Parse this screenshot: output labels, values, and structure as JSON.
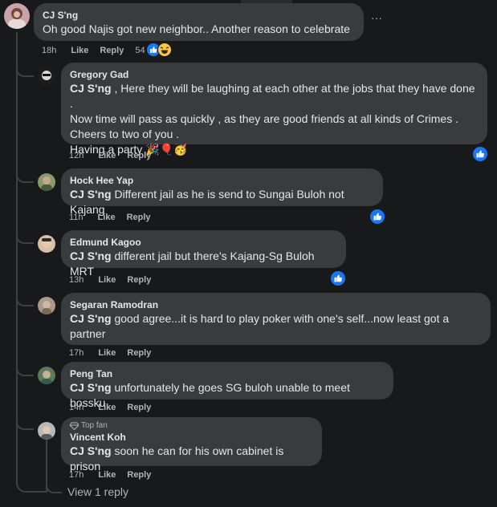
{
  "main_comment": {
    "author": "CJ S'ng",
    "text": "Oh good Najis got new neighbor.. Another reason to celebrate",
    "time": "18h",
    "like_label": "Like",
    "reply_label": "Reply",
    "reaction_count": "54",
    "more_label": "···"
  },
  "replies": [
    {
      "author": "Gregory Gad",
      "mention": "CJ S'ng",
      "lines": [
        " , Here they will be laughing at each other at the jobs that they have done .",
        "Now time will pass as quickly , as they are good friends at all kinds of Crimes .",
        "Cheers to two of you .",
        "Having a party 🎉🎈🥳"
      ],
      "time": "12h",
      "like_label": "Like",
      "reply_label": "Reply"
    },
    {
      "author": "Hock Hee Yap",
      "mention": "CJ S'ng",
      "text": " Different jail as he is send to Sungai Buloh not Kajang",
      "time": "11h",
      "like_label": "Like",
      "reply_label": "Reply"
    },
    {
      "author": "Edmund Kagoo",
      "mention": "CJ S'ng",
      "text": " different jail but there's Kajang-Sg Buloh MRT",
      "time": "13h",
      "like_label": "Like",
      "reply_label": "Reply"
    },
    {
      "author": "Segaran Ramodran",
      "mention": "CJ S'ng",
      "line1": " good agree...it is hard to play poker with one's self...now least got a",
      "line2": "partner",
      "time": "17h",
      "like_label": "Like",
      "reply_label": "Reply"
    },
    {
      "author": "Peng Tan",
      "mention": "CJ S'ng",
      "text": " unfortunately he goes SG buloh unable to meet bossku",
      "time": "14h",
      "like_label": "Like",
      "reply_label": "Reply"
    },
    {
      "badge": "Top fan",
      "author": "Vincent Koh",
      "mention": "CJ S'ng",
      "text": " soon he can for his own cabinet is prison",
      "time": "17h",
      "like_label": "Like",
      "reply_label": "Reply"
    }
  ],
  "view_replies": "View 1 reply",
  "colors": {
    "background": "#18191a",
    "bubble": "#3a3b3c",
    "secondary_text": "#b0b3b8",
    "like_blue": "#1877f2"
  },
  "icons": [
    "thumbs-up-icon",
    "haha-reaction-icon",
    "diamond-icon",
    "more-options-icon"
  ]
}
